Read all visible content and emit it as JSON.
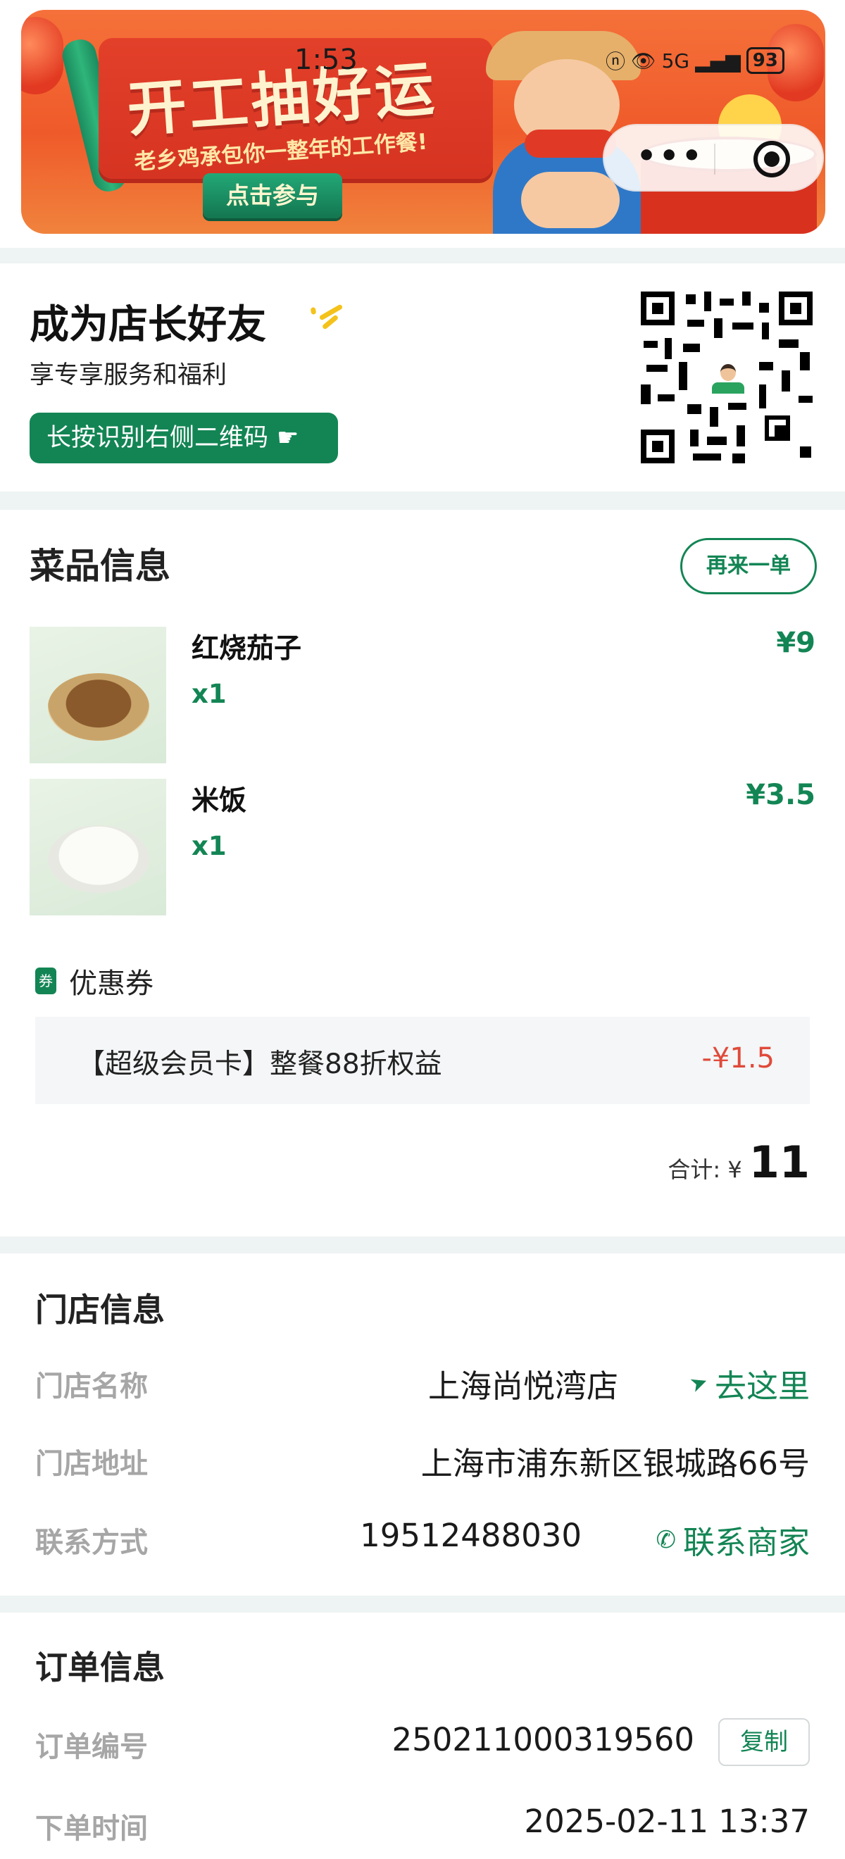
{
  "status_bar": {
    "time": "1:53",
    "network": "5G",
    "battery": "93"
  },
  "banner": {
    "title": "开工抽好运",
    "subtitle": "老乡鸡承包你一整年的工作餐!",
    "cta": "点击参与"
  },
  "capsule": {
    "more_icon": "more-dots-icon",
    "close_icon": "target-close-icon"
  },
  "friend_card": {
    "title": "成为店长好友",
    "subtitle": "享专享服务和福利",
    "button": "长按识别右侧二维码"
  },
  "dishes": {
    "title": "菜品信息",
    "reorder": "再来一单",
    "items": [
      {
        "name": "红烧茄子",
        "qty": "x1",
        "price": "¥9"
      },
      {
        "name": "米饭",
        "qty": "x1",
        "price": "¥3.5"
      }
    ],
    "coupon_tag": "券",
    "coupon_label": "优惠券",
    "coupon_name": "【超级会员卡】整餐88折权益",
    "coupon_amount": "-¥1.5",
    "total_label": "合计: ¥",
    "total_value": "11"
  },
  "store": {
    "title": "门店信息",
    "rows": [
      {
        "key": "门店名称",
        "value": "上海尚悦湾店",
        "action": "去这里"
      },
      {
        "key": "门店地址",
        "value": "上海市浦东新区银城路66号"
      },
      {
        "key": "联系方式",
        "value": "19512488030",
        "action": "联系商家"
      }
    ]
  },
  "order": {
    "title": "订单信息",
    "rows": [
      {
        "key": "订单编号",
        "value": "250211000319560",
        "action": "复制"
      },
      {
        "key": "下单时间",
        "value": "2025-02-11 13:37"
      }
    ]
  },
  "colors": {
    "brand_green": "#138554",
    "discount_red": "#e04a3a",
    "background": "#eef3f3"
  }
}
